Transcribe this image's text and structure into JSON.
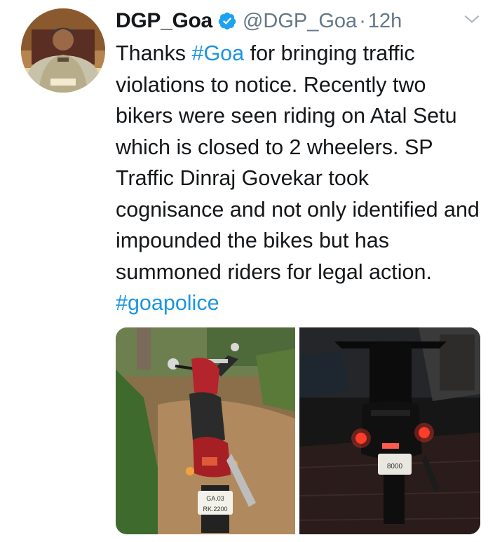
{
  "tweet": {
    "author_name": "DGP_Goa",
    "handle": "@DGP_Goa",
    "separator": "·",
    "time": "12h",
    "text": {
      "part1": "Thanks ",
      "hashtag1": "#Goa",
      "part2": " for bringing traffic violations to notice. Recently two bikers were seen riding on Atal Setu which is closed to 2 wheelers. SP Traffic Dinraj Govekar took cognisance and not only identified and impounded the bikes but has summoned riders for legal action. ",
      "hashtag2": "#goapolice"
    },
    "photos": {
      "left_plate": [
        "GA.03",
        "RK.2200"
      ],
      "right_plate": [
        "8000"
      ]
    }
  },
  "icons": {
    "verified": "verified-badge-icon",
    "caret": "chevron-down-icon"
  },
  "colors": {
    "hashtag": "#1b95e0",
    "secondary_text": "#657786",
    "verified": "#1da1f2"
  }
}
